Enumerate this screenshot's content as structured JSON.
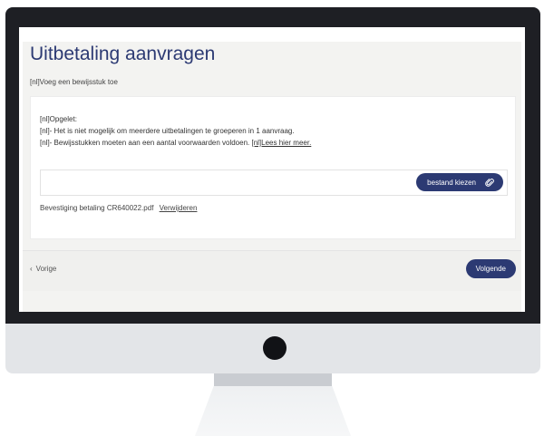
{
  "page": {
    "title": "Uitbetaling aanvragen",
    "subtitle": "[nl]Voeg een bewijsstuk toe"
  },
  "notice": {
    "line1": "[nl]Opgelet:",
    "line2": "[nl]- Het is niet mogelijk om meerdere uitbetalingen te groeperen in 1 aanvraag.",
    "line3_prefix": "[nl]- Bewijsstukken moeten aan een aantal voorwaarden voldoen. ",
    "line3_link": "[nl]Lees hier meer."
  },
  "upload": {
    "choose_label": "bestand kiezen",
    "choose_icon": "paperclip-icon"
  },
  "attached_file": {
    "name": "Bevestiging betaling CR640022.pdf",
    "remove_label": "Verwijderen"
  },
  "footer": {
    "prev_icon": "chevron-left-icon",
    "prev_label": "Vorige",
    "next_label": "Volgende"
  },
  "colors": {
    "brand": "#2c3a73",
    "bezel": "#1e1f24",
    "panel": "#f3f3f1"
  }
}
